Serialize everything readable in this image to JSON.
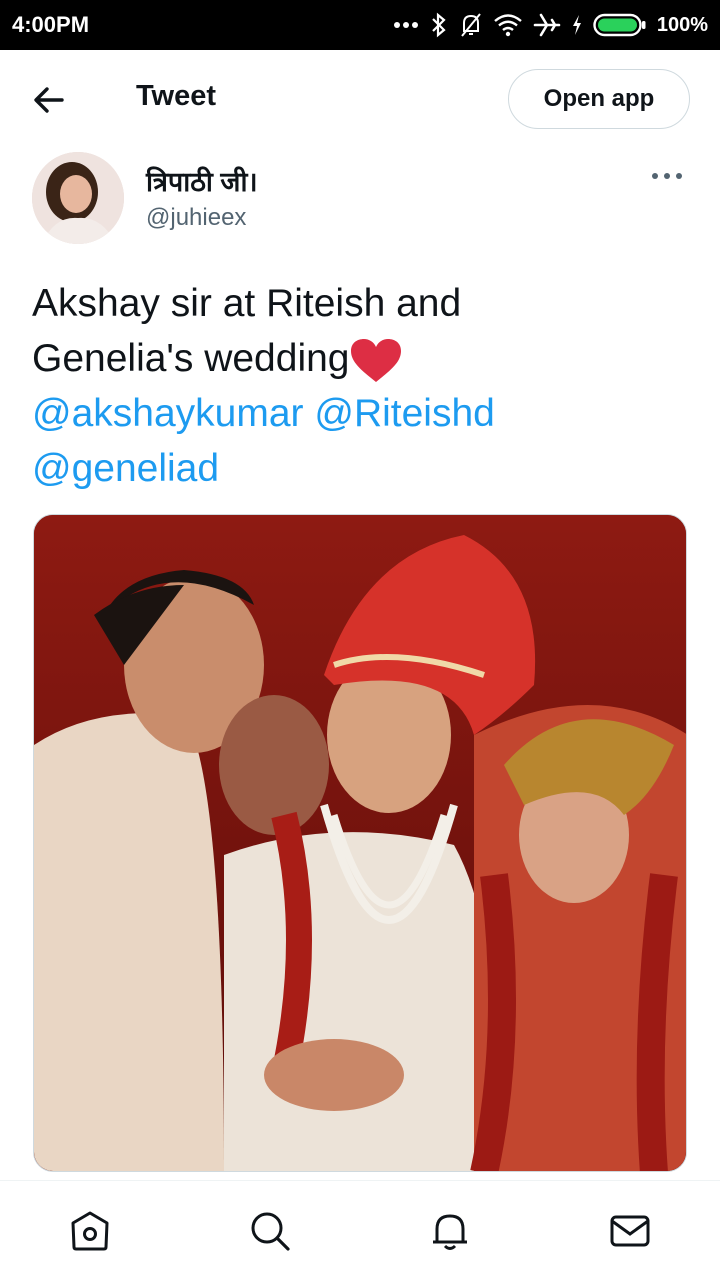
{
  "status_bar": {
    "time": "4:00PM",
    "battery": "100%",
    "icons": [
      "more-dots-icon",
      "bluetooth-icon",
      "notifications-off-icon",
      "wifi-icon",
      "airplane-icon",
      "charging-icon",
      "battery-icon"
    ]
  },
  "header": {
    "title": "Tweet",
    "open_app_label": "Open app",
    "back_icon": "arrow-left-icon"
  },
  "tweet": {
    "author": {
      "display_name": "त्रिपाठी जी।",
      "handle": "@juhieex"
    },
    "text_line1": "Akshay sir at Riteish and",
    "text_line2": "Genelia's wedding",
    "mentions": [
      "@akshaykumar",
      "@Riteishd",
      "@geneliad"
    ],
    "media_description_icon": "photo"
  },
  "bottom_nav": {
    "items": [
      "home-icon",
      "search-icon",
      "notifications-icon",
      "messages-icon"
    ]
  },
  "colors": {
    "accent": "#1d9bf0",
    "text": "#0f1419",
    "secondary": "#536471",
    "heart": "#e0245e"
  }
}
